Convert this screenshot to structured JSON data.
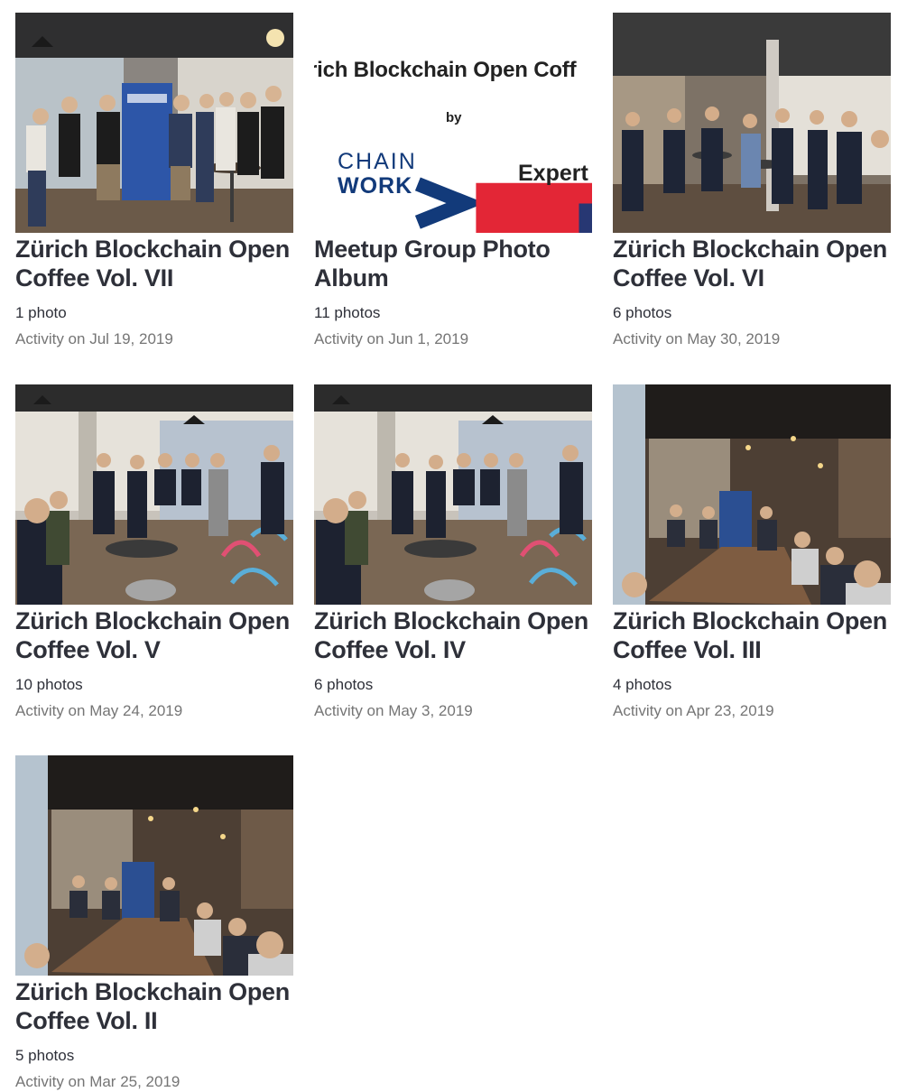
{
  "albums": [
    {
      "title": "Zürich Blockchain Open Coffee Vol. VII",
      "count": "1 photo",
      "activity": "Activity on Jul 19, 2019",
      "thumb_icon": "photo-group"
    },
    {
      "title": "Meetup Group Photo Album",
      "count": "11 photos",
      "activity": "Activity on Jun 1, 2019",
      "thumb_icon": "event-logo",
      "thumb_text": {
        "headline": "rich Blockchain Open Coff",
        "by": "by",
        "logo_left_top": "CHAIN",
        "logo_left_bottom": "WORK",
        "logo_right": "Expert"
      }
    },
    {
      "title": "Zürich Blockchain Open Coffee Vol. VI",
      "count": "6 photos",
      "activity": "Activity on May 30, 2019",
      "thumb_icon": "photo-group"
    },
    {
      "title": "Zürich Blockchain Open Coffee Vol. V",
      "count": "10 photos",
      "activity": "Activity on May 24, 2019",
      "thumb_icon": "photo-group"
    },
    {
      "title": "Zürich Blockchain Open Coffee Vol. IV",
      "count": "6 photos",
      "activity": "Activity on May 3, 2019",
      "thumb_icon": "photo-group"
    },
    {
      "title": "Zürich Blockchain Open Coffee Vol. III",
      "count": "4 photos",
      "activity": "Activity on Apr 23, 2019",
      "thumb_icon": "photo-meeting"
    },
    {
      "title": "Zürich Blockchain Open Coffee Vol. II",
      "count": "5 photos",
      "activity": "Activity on Mar 25, 2019",
      "thumb_icon": "photo-meeting"
    }
  ],
  "colors": {
    "title": "#2e3039",
    "secondary": "#757575",
    "logo_blue": "#123a7a",
    "logo_red": "#e32636"
  }
}
